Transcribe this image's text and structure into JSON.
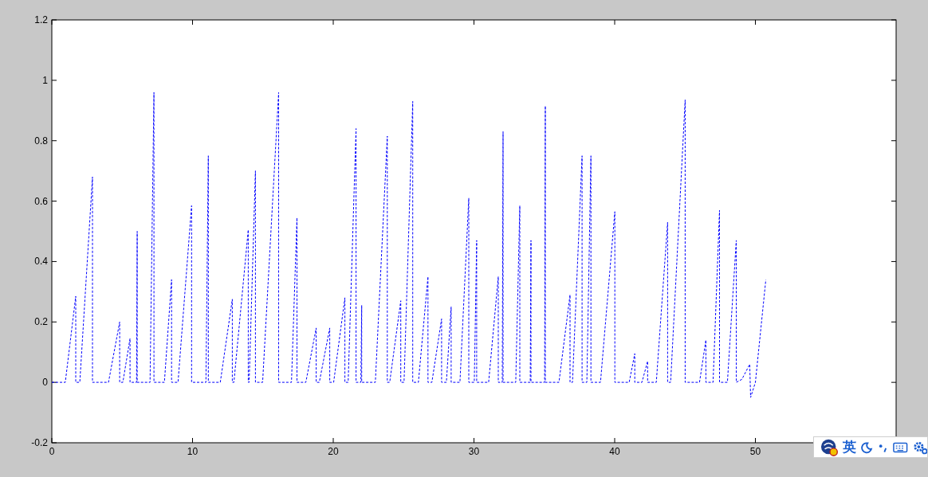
{
  "chart_data": {
    "type": "line",
    "xlim": [
      0,
      60
    ],
    "ylim": [
      -0.2,
      1.2
    ],
    "xticks": [
      0,
      10,
      20,
      30,
      40,
      50
    ],
    "yticks": [
      -0.2,
      0,
      0.2,
      0.4,
      0.6,
      0.8,
      1,
      1.2
    ],
    "x": [
      0,
      0.96,
      1.7,
      1.7,
      1.99,
      2.89,
      2.89,
      4.03,
      4.82,
      4.82,
      5.05,
      5.56,
      5.56,
      6.02,
      6.07,
      6.07,
      6.98,
      7.26,
      7.26,
      8.0,
      8.51,
      8.51,
      8.97,
      9.93,
      9.93,
      10.95,
      11.12,
      11.12,
      11.97,
      12.83,
      12.83,
      12.94,
      13.96,
      13.96,
      14.02,
      14.47,
      14.47,
      14.98,
      16.12,
      16.12,
      17.03,
      17.42,
      17.42,
      18.05,
      18.79,
      18.79,
      19.01,
      19.75,
      19.75,
      20.03,
      20.83,
      20.83,
      21.06,
      21.62,
      21.62,
      21.96,
      22.02,
      22.02,
      22.99,
      23.84,
      23.84,
      24.01,
      24.8,
      24.8,
      25.03,
      25.65,
      25.65,
      26.05,
      26.73,
      26.73,
      27.01,
      27.7,
      27.7,
      28.04,
      28.38,
      28.38,
      29.0,
      29.63,
      29.63,
      30.02,
      30.19,
      30.19,
      31.04,
      31.73,
      31.73,
      32.01,
      32.07,
      32.07,
      32.97,
      33.26,
      33.26,
      34.0,
      34.05,
      34.05,
      35.02,
      35.07,
      35.07,
      36.04,
      36.83,
      36.83,
      37.0,
      37.68,
      37.68,
      38.02,
      38.31,
      38.31,
      38.99,
      40.01,
      40.01,
      41.03,
      41.43,
      41.43,
      41.94,
      42.34,
      42.34,
      42.96,
      43.76,
      43.76,
      43.98,
      45.01,
      45.01,
      46.03,
      46.48,
      46.48,
      46.99,
      47.45,
      47.45,
      48.01,
      48.64,
      48.64,
      49.04,
      49.6,
      49.66,
      50.0,
      50.74
    ],
    "series": [
      {
        "color": "#0000ff",
        "line_style": "dashed",
        "values": [
          0,
          0,
          0.285,
          0,
          0,
          0.68,
          0,
          0,
          0.2,
          0,
          0,
          0.145,
          0,
          0,
          0.5,
          0,
          0,
          0.96,
          0,
          0,
          0.34,
          0,
          0,
          0.585,
          0,
          0,
          0.75,
          0,
          0,
          0.275,
          0,
          0,
          0.505,
          0,
          0,
          0.7,
          0,
          0,
          0.96,
          0,
          0,
          0.545,
          0,
          0,
          0.18,
          0,
          0,
          0.18,
          0,
          0,
          0.28,
          0,
          0,
          0.84,
          0,
          0,
          0.255,
          0,
          0,
          0.815,
          0,
          0,
          0.27,
          0,
          0,
          0.93,
          0,
          0,
          0.35,
          0,
          0,
          0.21,
          0,
          0,
          0.25,
          0,
          0,
          0.61,
          0,
          0,
          0.47,
          0,
          0,
          0.35,
          0,
          0,
          0.83,
          0,
          0,
          0.585,
          0,
          0,
          0.47,
          0,
          0,
          0.915,
          0,
          0,
          0.29,
          0,
          0,
          0.75,
          0,
          0,
          0.75,
          0,
          0,
          0.565,
          0,
          0,
          0.095,
          0,
          0,
          0.07,
          0,
          0,
          0.53,
          0,
          0,
          0.935,
          0,
          0,
          0.14,
          0,
          0,
          0.57,
          0,
          0,
          0.47,
          0,
          0.01,
          0.06,
          -0.05,
          0,
          0.34
        ]
      }
    ]
  },
  "ime_toolbar": {
    "language": "英"
  }
}
